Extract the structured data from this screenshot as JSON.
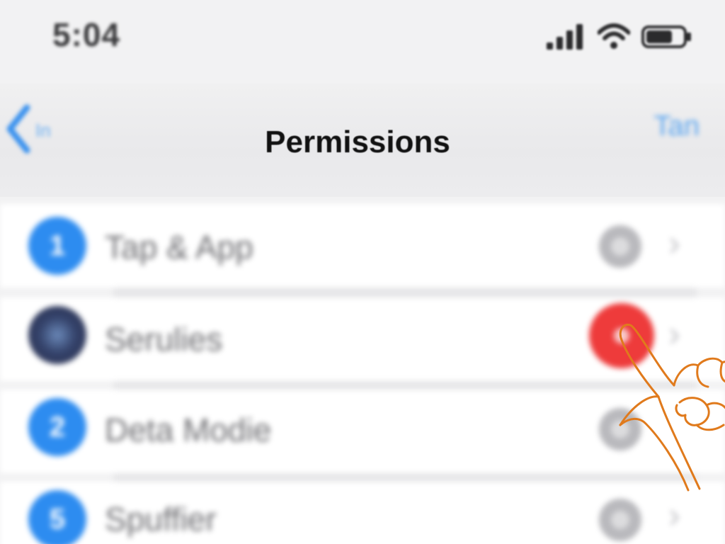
{
  "status_bar": {
    "time": "5:04",
    "icons": [
      "signal-icon",
      "wifi-icon",
      "battery-icon"
    ]
  },
  "nav": {
    "back_label": "In",
    "title": "Permissions",
    "action_label": "Tan"
  },
  "list": {
    "items": [
      {
        "badge": "1",
        "label": "Tap & App",
        "icon": "number-badge-icon",
        "toggle_state": "off"
      },
      {
        "badge": "",
        "label": "Serulies",
        "icon": "globe-avatar-icon",
        "toggle_state": "active"
      },
      {
        "badge": "2",
        "label": "Deta Modie",
        "icon": "number-badge-icon",
        "toggle_state": "off"
      },
      {
        "badge": "5",
        "label": "Spuffier",
        "icon": "number-badge-icon",
        "toggle_state": "off"
      }
    ]
  },
  "colors": {
    "accent": "#2d8cf0",
    "active_toggle": "#ee3b3b",
    "hand_outline": "#e07a1c"
  },
  "overlay": {
    "icon": "tapping-hand-icon"
  }
}
